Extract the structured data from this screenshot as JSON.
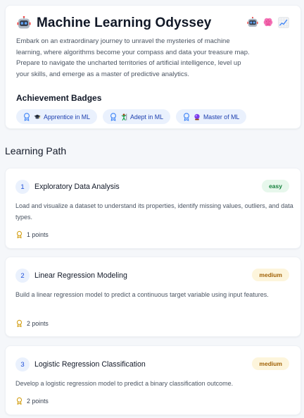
{
  "hero": {
    "title": "Machine Learning Odyssey",
    "title_icon": "robot-icon",
    "header_icons": [
      "robot-icon",
      "brain-icon",
      "chart-increasing-icon"
    ],
    "description": "Embark on an extraordinary journey to unravel the mysteries of machine learning, where algorithms become your compass and data your treasure map. Prepare to navigate the uncharted territories of artificial intelligence, level up your skills, and emerge as a master of predictive analytics.",
    "badges_title": "Achievement Badges",
    "badges": [
      {
        "label": "Apprentice in ML",
        "icon": "graduation-cap-icon"
      },
      {
        "label": "Adept in ML",
        "icon": "person-climbing-icon"
      },
      {
        "label": "Master of ML",
        "icon": "crystal-ball-icon"
      }
    ]
  },
  "learning_path": {
    "title": "Learning Path",
    "steps": [
      {
        "number": "1",
        "title": "Exploratory Data Analysis",
        "difficulty": "easy",
        "description": "Load and visualize a dataset to understand its properties, identify missing values, outliers, and data types.",
        "points": "1 points"
      },
      {
        "number": "2",
        "title": "Linear Regression Modeling",
        "difficulty": "medium",
        "description": "Build a linear regression model to predict a continuous target variable using input features.",
        "points": "2 points"
      },
      {
        "number": "3",
        "title": "Logistic Regression Classification",
        "difficulty": "medium",
        "description": "Develop a logistic regression model to predict a binary classification outcome.",
        "points": "2 points"
      }
    ]
  },
  "colors": {
    "accent": "#1d4ed8",
    "badge_bg": "#eaf1fd",
    "easy_bg": "#e7f7ec",
    "easy_text": "#15803d",
    "medium_bg": "#fdf5dc",
    "medium_text": "#a16207",
    "medal": "#d4a017"
  }
}
